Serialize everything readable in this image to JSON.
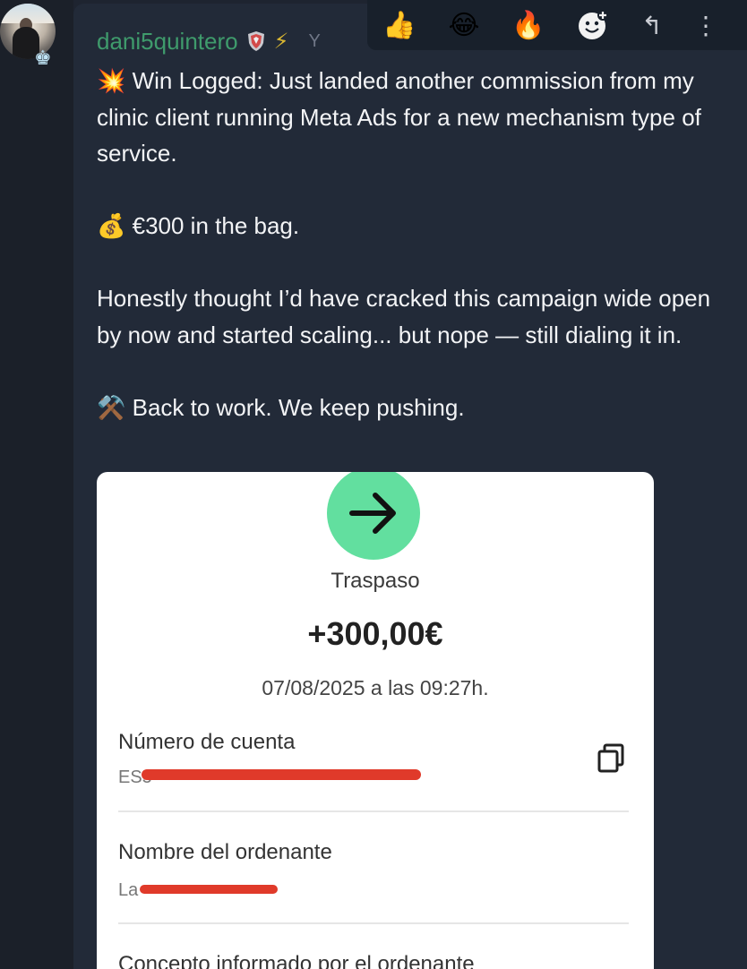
{
  "author": {
    "username": "dani5quintero",
    "timestamp_partial": "Y"
  },
  "toolbar": {
    "reactions": [
      "👍",
      "😂",
      "🔥"
    ],
    "add_reaction_icon": "add-reaction-icon",
    "reply_icon": "↰",
    "more_icon": "⋮"
  },
  "message": {
    "line1_emoji": "💥",
    "line1_text": "Win Logged: Just landed another commission from my clinic client running Meta Ads for a new mechanism type of service.",
    "line2_emoji": "💰",
    "line2_text": "€300 in the bag.",
    "line3_text": "Honestly thought I’d have cracked this campaign wide open by now and started scaling... but nope — still dialing it in.",
    "line4_emoji": "⚒️",
    "line4_text": "Back to work. We keep pushing."
  },
  "attachment": {
    "title": "Traspaso",
    "amount": "+300,00€",
    "datetime": "07/08/2025 a las 09:27h.",
    "field1_label": "Número de cuenta",
    "field1_value_prefix": "ES5",
    "field2_label": "Nombre del ordenante",
    "field2_value_prefix": "La",
    "field3_label": "Concepto informado por el ordenante"
  }
}
